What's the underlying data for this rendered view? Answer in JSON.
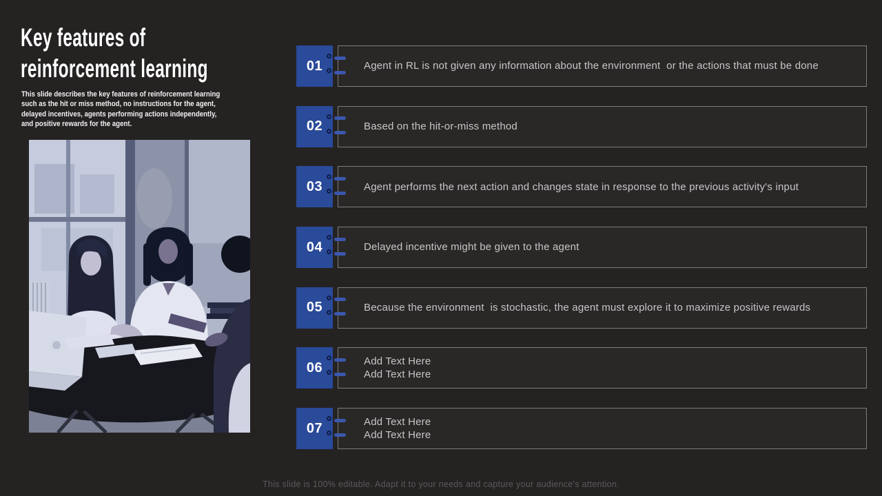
{
  "title": {
    "lines": [
      "Key features of",
      "reinforcement learning"
    ]
  },
  "description": {
    "lines": [
      "This slide describes the key features of reinforcement learning",
      "such as the hit or miss method, no instructions for the agent,",
      "delayed incentives, agents performing actions independently,",
      "and positive rewards for the agent."
    ]
  },
  "features": [
    {
      "number": "01",
      "lines": [
        "Agent in RL is not given any information about the environment  or the actions that must be done"
      ]
    },
    {
      "number": "02",
      "lines": [
        "Based on the hit-or-miss method"
      ]
    },
    {
      "number": "03",
      "lines": [
        "Agent performs the next action and changes state in response to the previous activity's input"
      ]
    },
    {
      "number": "04",
      "lines": [
        "Delayed incentive might be given to the agent"
      ]
    },
    {
      "number": "05",
      "lines": [
        "Because the environment  is stochastic, the agent must explore it to maximize positive rewards"
      ]
    },
    {
      "number": "06",
      "lines": [
        "Add Text Here",
        "Add Text Here"
      ]
    },
    {
      "number": "07",
      "lines": [
        "Add Text Here",
        "Add Text Here"
      ]
    }
  ],
  "footer": "This slide is 100% editable. Adapt it to your needs and capture your audience's attention.",
  "icons": {
    "connector": "link-ring-and-bar-icon"
  },
  "colors": {
    "bg": "#252222",
    "box-bg": "#2a2727",
    "box-border": "#7d7d7d",
    "accent": "#2a4a9a",
    "pill": "#3b57ae",
    "ring": "#0f1d4a",
    "body-text": "#c7c7c7",
    "footer-text": "#5b5b5b"
  }
}
